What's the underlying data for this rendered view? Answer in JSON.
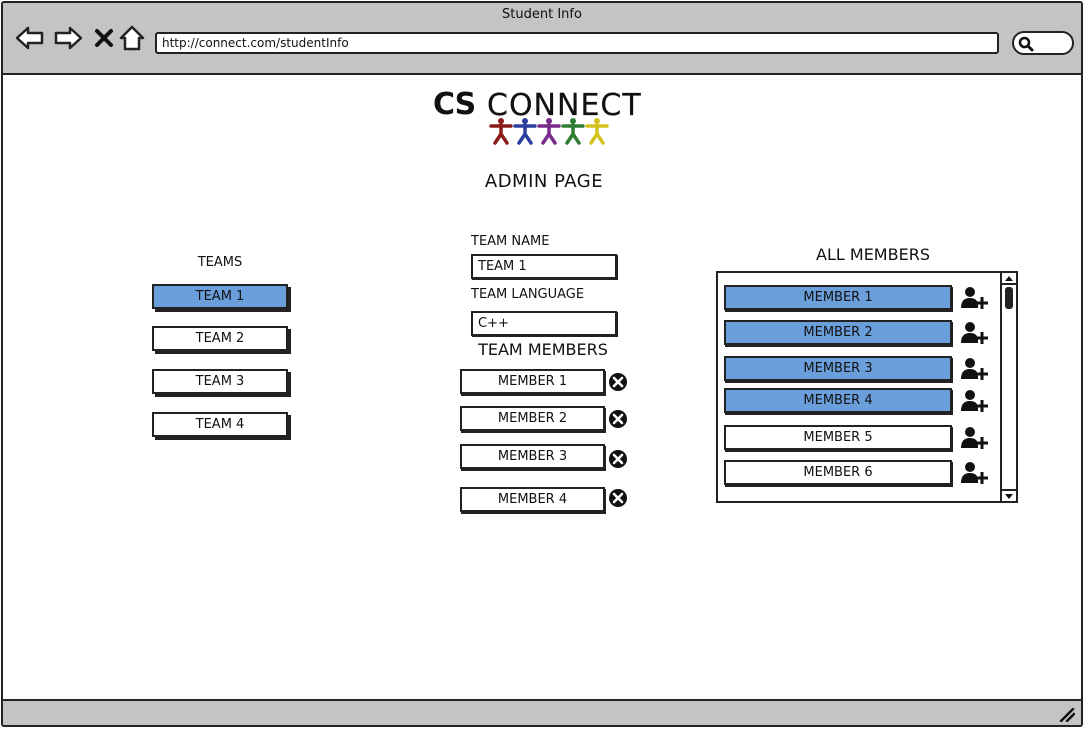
{
  "window": {
    "title": "Student Info"
  },
  "browser": {
    "url": "http://connect.com/studentInfo",
    "icons": [
      "back-arrow-icon",
      "forward-arrow-icon",
      "close-x-icon",
      "home-icon",
      "search-icon"
    ]
  },
  "logo": {
    "cs": "CS",
    "connect": "CONNECT",
    "people_colors": [
      "#8b1a1a",
      "#2a3f9e",
      "#7a2a8a",
      "#2e7d32",
      "#d4c21c"
    ]
  },
  "page": {
    "title": "ADMIN PAGE"
  },
  "teams": {
    "heading": "TEAMS",
    "items": [
      {
        "label": "TEAM 1",
        "selected": true
      },
      {
        "label": "TEAM 2",
        "selected": false
      },
      {
        "label": "TEAM 3",
        "selected": false
      },
      {
        "label": "TEAM 4",
        "selected": false
      }
    ]
  },
  "form": {
    "team_name_label": "TEAM NAME",
    "team_name_value": "TEAM 1",
    "team_language_label": "TEAM LANGUAGE",
    "team_language_value": "C++",
    "members_heading": "TEAM MEMBERS",
    "members": [
      {
        "label": "MEMBER 1"
      },
      {
        "label": "MEMBER 2"
      },
      {
        "label": "MEMBER 3"
      },
      {
        "label": "MEMBER 4"
      }
    ]
  },
  "all_members": {
    "heading": "ALL MEMBERS",
    "items": [
      {
        "label": "MEMBER 1",
        "selected": true
      },
      {
        "label": "MEMBER 2",
        "selected": true
      },
      {
        "label": "MEMBER 3",
        "selected": true
      },
      {
        "label": "MEMBER 4",
        "selected": true
      },
      {
        "label": "MEMBER 5",
        "selected": false
      },
      {
        "label": "MEMBER 6",
        "selected": false
      }
    ]
  },
  "colors": {
    "chrome": "#c4c4c4",
    "selected": "#6b9fdb",
    "stroke": "#222222"
  }
}
